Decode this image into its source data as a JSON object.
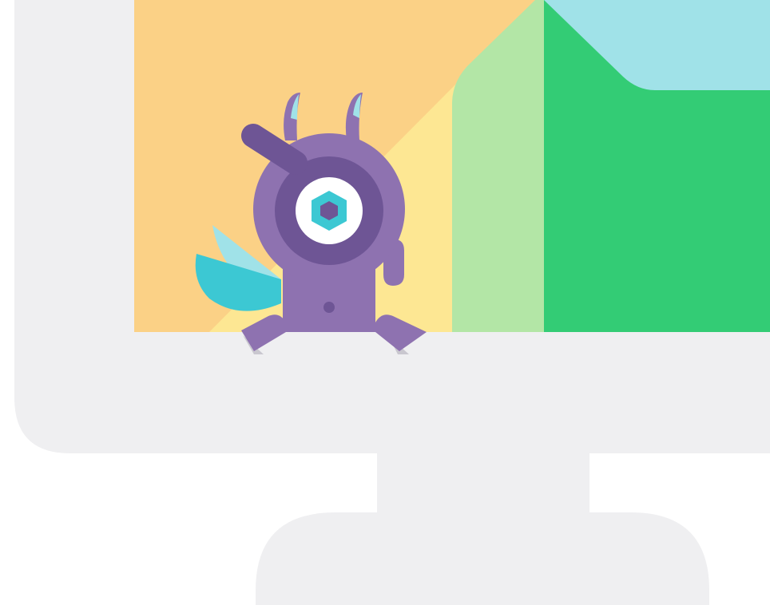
{
  "illustration": {
    "subject": "computer-monitor-with-robot-mascot",
    "icons": [
      "monitor-icon",
      "robot-mascot-icon",
      "hexagon-eye-icon"
    ]
  },
  "colors": {
    "background": "#ffffff",
    "monitor": "#efeff1",
    "screen_orange": "#fbd186",
    "screen_yellow": "#fde793",
    "screen_light_green": "#b3e6a6",
    "screen_green": "#33cc75",
    "screen_blue": "#a0e2e8",
    "robot_purple": "#8e72b0",
    "robot_dark_purple": "#6e5595",
    "robot_eye_white": "#ffffff",
    "robot_eye_teal": "#3cc8d3",
    "wing_teal": "#3cc8d3",
    "wing_light": "#a0e2e8"
  }
}
